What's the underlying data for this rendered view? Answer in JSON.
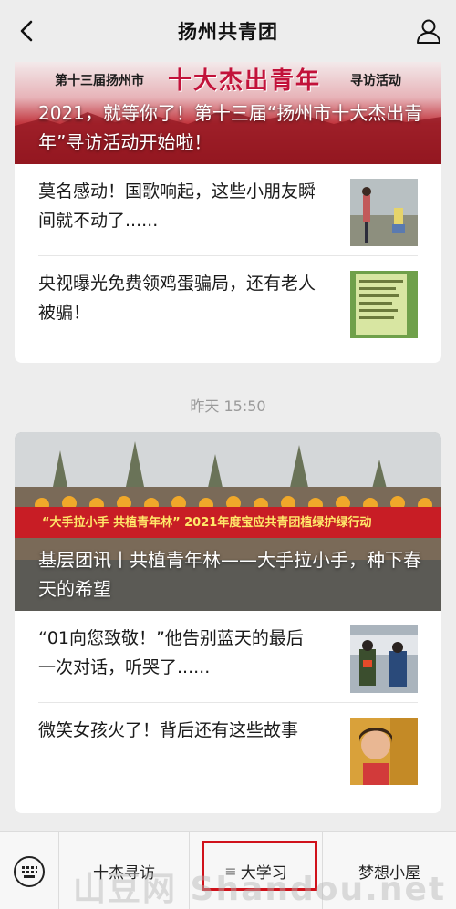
{
  "header": {
    "title": "扬州共青团",
    "back_icon": "chevron-left-icon",
    "profile_icon": "user-icon"
  },
  "card1": {
    "banner_left": "第十三届扬州市",
    "banner_big": "十大杰出青年",
    "banner_right": "寻访活动",
    "hero_title": "2021，就等你了！第十三届“扬州市十大杰出青年”寻访活动开始啦！",
    "items": [
      {
        "text": "莫名感动！国歌响起，这些小朋友瞬间就不动了......"
      },
      {
        "text": "央视曝光免费领鸡蛋骗局，还有老人被骗！"
      }
    ]
  },
  "timestamp": "昨天 15:50",
  "card2": {
    "banner_text": "“大手拉小手 共植青年林” 2021年度宝应共青团植绿护绿行动",
    "hero_title": "基层团讯丨共植青年林——大手拉小手，种下春天的希望",
    "items": [
      {
        "text": "“01向您致敬！”他告别蓝天的最后一次对话，听哭了......"
      },
      {
        "text": "微笑女孩火了！背后还有这些故事"
      }
    ]
  },
  "bottom_menu": {
    "keyboard_icon": "keyboard-icon",
    "items": [
      {
        "label": "十杰寻访"
      },
      {
        "label": "大学习",
        "glyph": "≡"
      },
      {
        "label": "梦想小屋"
      }
    ]
  },
  "watermark": "山豆网 Shandou.net",
  "colors": {
    "accent_red": "#d0121b",
    "banner_red": "#c2123a",
    "background": "#ededed"
  }
}
